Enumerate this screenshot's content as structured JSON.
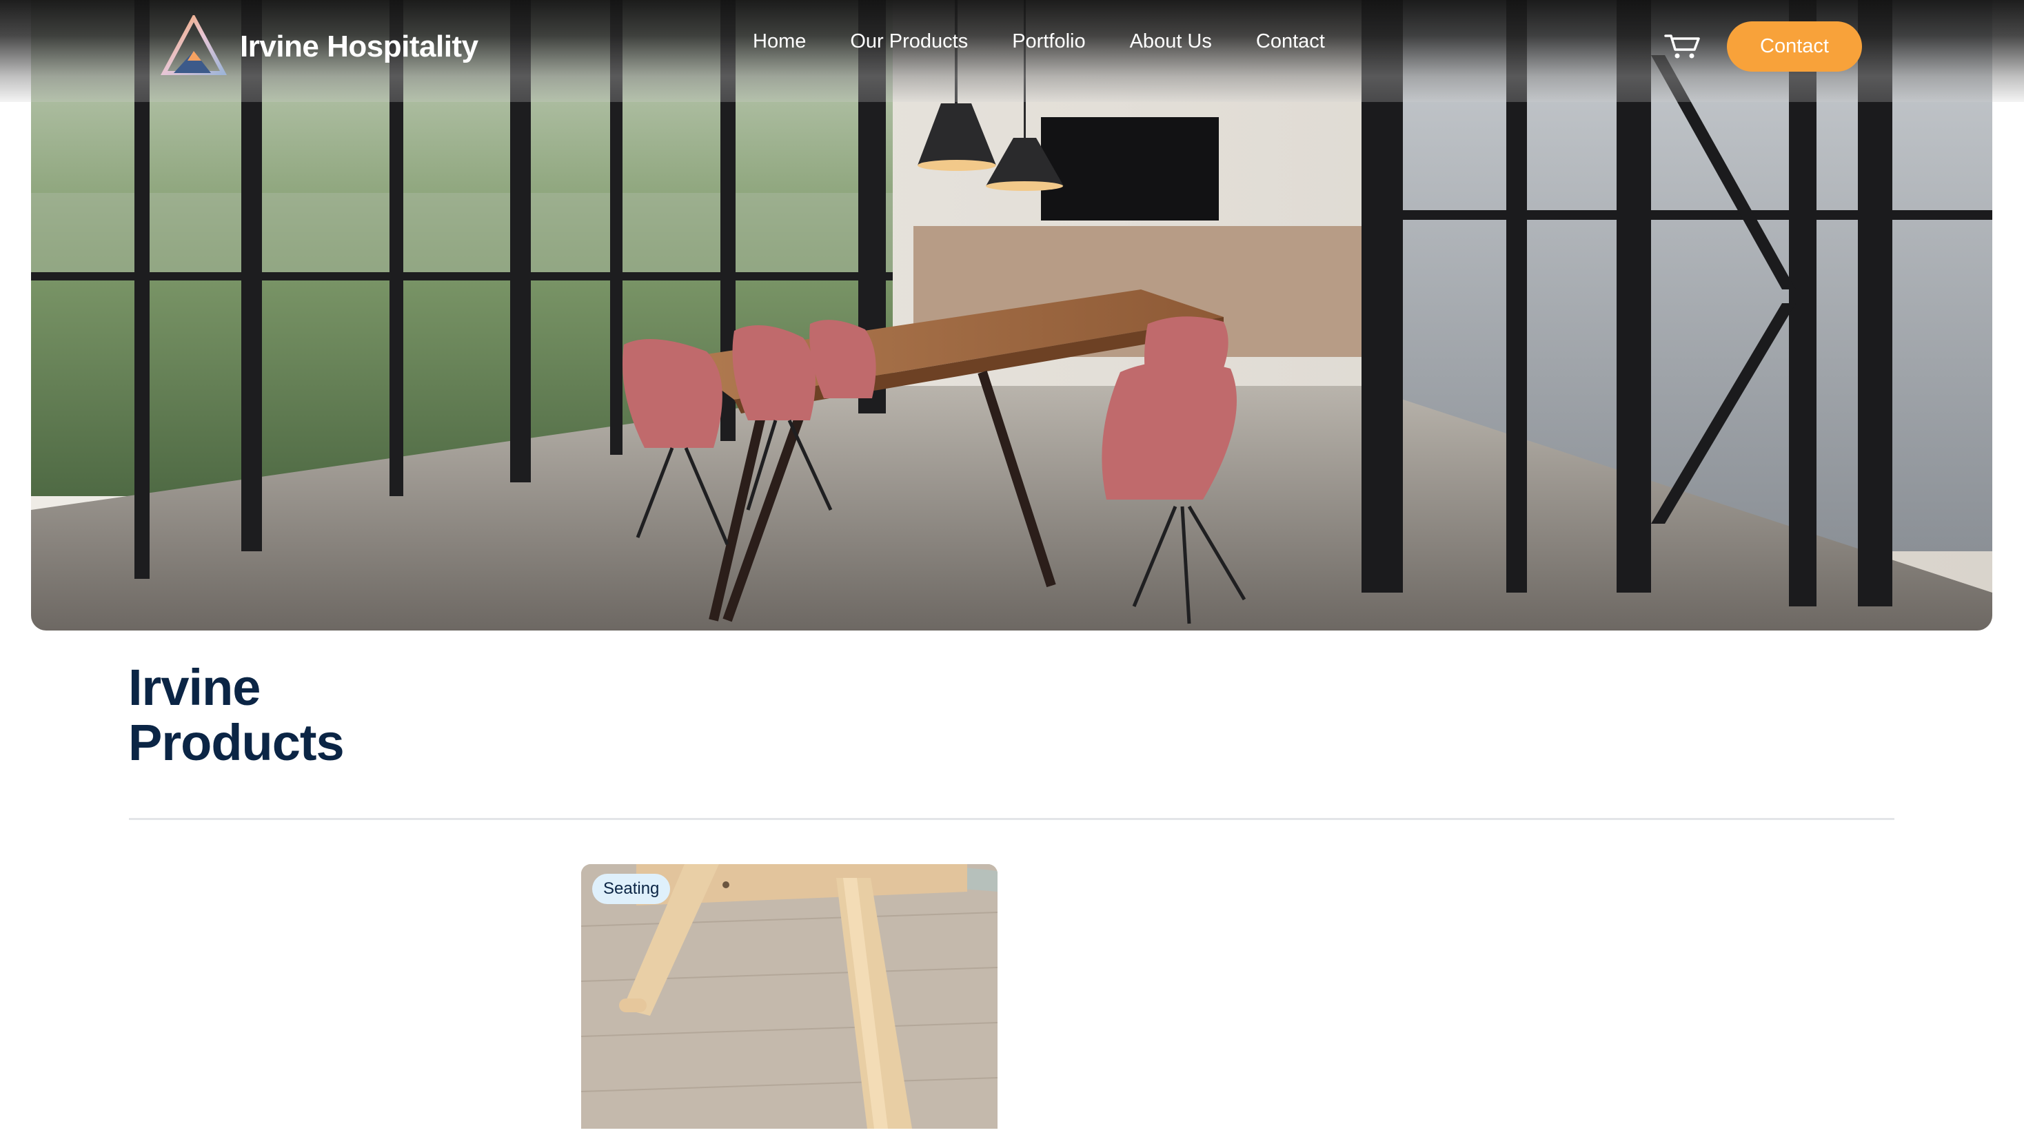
{
  "header": {
    "brand": "Irvine Hospitality",
    "nav": [
      "Home",
      "Our Products",
      "Portfolio",
      "About Us",
      "Contact"
    ],
    "cta_label": "Contact",
    "cart_icon": "shopping-cart-icon",
    "logo_icon": "triangle-mountain-logo"
  },
  "hero": {
    "image": "modern conference room with wooden table, pink chairs and floor-to-ceiling windows"
  },
  "page": {
    "title_line1": "Irvine",
    "title_line2": "Products"
  },
  "products": [
    {
      "category": "Seating",
      "image": "wooden chair leg on light wood floor"
    }
  ],
  "colors": {
    "accent": "#f8a23a",
    "heading": "#0b2545",
    "badge_bg": "#dff0fb",
    "divider": "#e3e5e8"
  }
}
